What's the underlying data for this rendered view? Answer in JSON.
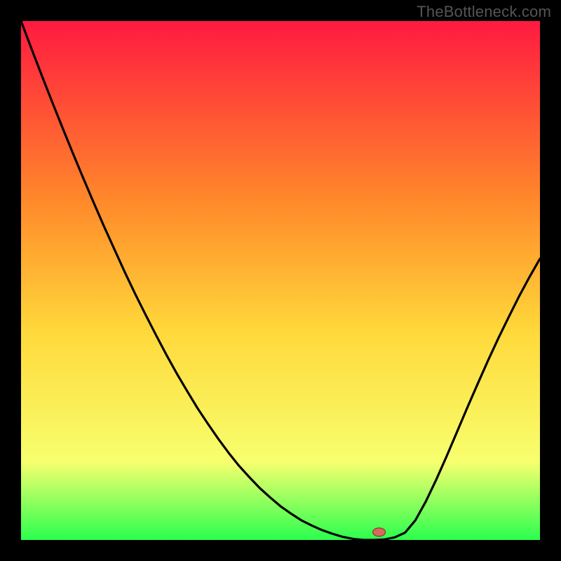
{
  "watermark": "TheBottleneck.com",
  "colors": {
    "page_bg": "#000000",
    "grad_top": "#ff1a40",
    "grad_mid1": "#ff8a2a",
    "grad_mid2": "#ffd93b",
    "grad_mid3": "#f7ff6e",
    "grad_bottom": "#2bff4e",
    "curve": "#000000",
    "marker_fill": "#d46a5e",
    "marker_stroke": "#8d3a30"
  },
  "chart_data": {
    "type": "line",
    "title": "",
    "xlabel": "",
    "ylabel": "",
    "xlim": [
      0,
      100
    ],
    "ylim": [
      0,
      100
    ],
    "x": [
      0,
      2,
      4,
      6,
      8,
      10,
      12,
      14,
      16,
      18,
      20,
      22,
      24,
      26,
      28,
      30,
      32,
      34,
      36,
      38,
      40,
      42,
      44,
      46,
      48,
      50,
      52,
      54,
      56,
      58,
      60,
      62,
      64,
      66,
      68,
      70,
      72,
      74,
      76,
      78,
      80,
      82,
      84,
      86,
      88,
      90,
      92,
      94,
      96,
      98,
      100
    ],
    "values": [
      100.0,
      94.7,
      89.5,
      84.4,
      79.4,
      74.5,
      69.7,
      65.0,
      60.4,
      56.0,
      51.6,
      47.4,
      43.4,
      39.5,
      35.7,
      32.1,
      28.7,
      25.4,
      22.4,
      19.5,
      16.8,
      14.3,
      12.1,
      10.0,
      8.2,
      6.5,
      5.1,
      3.8,
      2.8,
      1.9,
      1.2,
      0.6,
      0.2,
      0.0,
      0.0,
      0.1,
      0.5,
      1.4,
      3.8,
      7.4,
      11.6,
      16.1,
      20.8,
      25.5,
      30.1,
      34.6,
      38.9,
      43.0,
      47.0,
      50.7,
      54.2
    ],
    "marker": {
      "x": 69,
      "y": 1.5
    }
  }
}
